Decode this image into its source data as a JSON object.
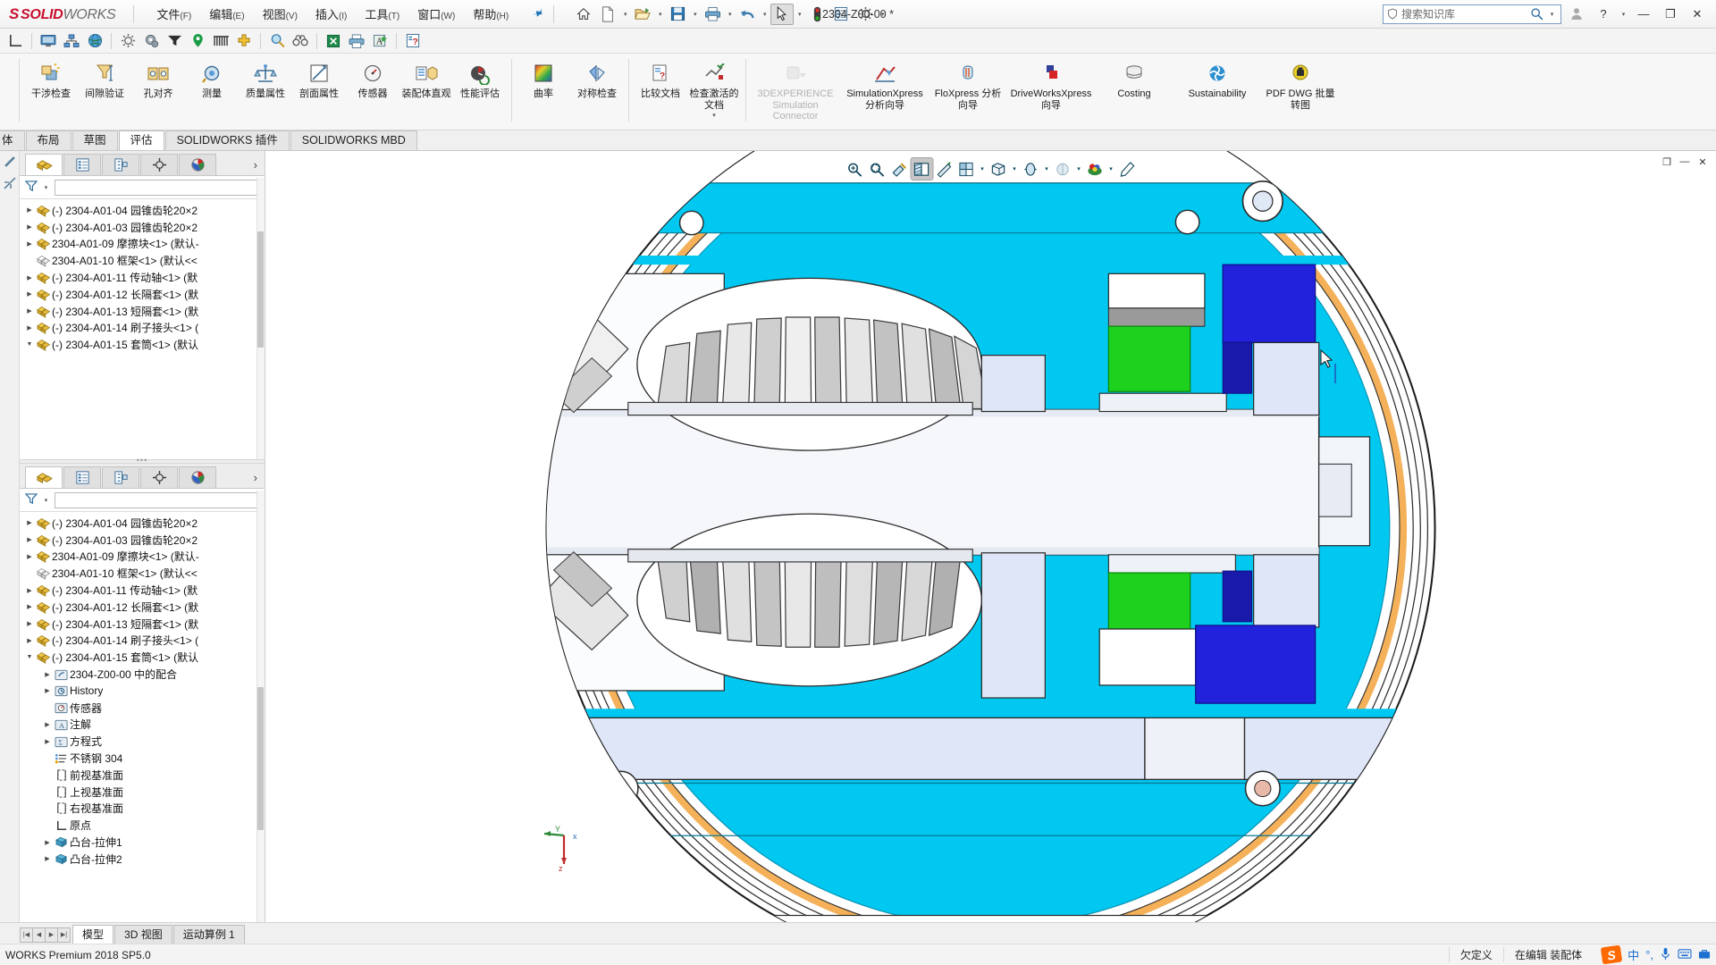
{
  "app": {
    "brand_mark": "S",
    "brand_solid": "SOLID",
    "brand_works": "WORKS",
    "document_title": "2304-Z00-00 *",
    "status_version": "WORKS Premium 2018 SP5.0",
    "accent_red": "#c8102e",
    "viewport_bg": "#00c8f0"
  },
  "menubar": [
    {
      "label": "文件",
      "mnemonic": "(F)"
    },
    {
      "label": "编辑",
      "mnemonic": "(E)"
    },
    {
      "label": "视图",
      "mnemonic": "(V)"
    },
    {
      "label": "插入",
      "mnemonic": "(I)"
    },
    {
      "label": "工具",
      "mnemonic": "(T)"
    },
    {
      "label": "窗口",
      "mnemonic": "(W)"
    },
    {
      "label": "帮助",
      "mnemonic": "(H)"
    }
  ],
  "quick_access": [
    {
      "name": "home-icon",
      "caret": false
    },
    {
      "name": "new-document-icon",
      "caret": true
    },
    {
      "name": "open-folder-icon",
      "caret": true
    },
    {
      "name": "save-icon",
      "caret": true
    },
    {
      "name": "print-icon",
      "caret": true
    },
    {
      "name": "undo-icon",
      "caret": true
    },
    {
      "name": "select-cursor-icon",
      "caret": true,
      "pressed": true
    },
    {
      "name": "rebuild-icon",
      "caret": false
    },
    {
      "name": "file-properties-icon",
      "caret": false
    },
    {
      "name": "options-gear-icon",
      "caret": true
    }
  ],
  "search": {
    "placeholder": "搜索知识库",
    "shield_icon": "knowledge-shield-icon",
    "magnifier_icon": "search-icon"
  },
  "window_controls": {
    "account": "user-account-icon",
    "help": "?",
    "help_caret": "▾",
    "minimize": "—",
    "restore": "❐",
    "close": "✕"
  },
  "toolbar2": [
    {
      "name": "coordinate-system-icon",
      "group": 0
    },
    {
      "name": "display-monitor-icon",
      "group": 1
    },
    {
      "name": "assembly-tree-icon",
      "group": 1
    },
    {
      "name": "globe-icon",
      "group": 1
    },
    {
      "name": "gear-settings-icon",
      "group": 2
    },
    {
      "name": "gears-icon",
      "group": 2
    },
    {
      "name": "funnel-icon",
      "group": 2
    },
    {
      "name": "location-pin-icon",
      "group": 2
    },
    {
      "name": "comb-icon",
      "group": 2
    },
    {
      "name": "add-yellow-cross-icon",
      "group": 2
    },
    {
      "name": "zoom-search-icon",
      "group": 3
    },
    {
      "name": "binoculars-icon",
      "group": 3
    },
    {
      "name": "excel-export-icon",
      "group": 4
    },
    {
      "name": "print-preview-icon",
      "group": 4
    },
    {
      "name": "text-image-icon",
      "group": 4
    },
    {
      "name": "help-document-icon",
      "group": 5
    }
  ],
  "ribbon": {
    "groups": [
      {
        "buttons": [
          {
            "label": "干涉检查",
            "icon": "interference-check-icon",
            "width": "normal",
            "disabled": false
          },
          {
            "label": "间隙验证",
            "icon": "clearance-verify-icon",
            "width": "normal",
            "disabled": false
          },
          {
            "label": "孔对齐",
            "icon": "hole-alignment-icon",
            "width": "normal",
            "disabled": false
          },
          {
            "label": "测量",
            "icon": "measure-icon",
            "width": "normal",
            "disabled": false
          },
          {
            "label": "质量属性",
            "icon": "mass-properties-icon",
            "width": "normal",
            "disabled": false
          },
          {
            "label": "剖面属性",
            "icon": "section-properties-icon",
            "width": "normal",
            "disabled": false
          },
          {
            "label": "传感器",
            "icon": "sensor-icon",
            "width": "normal",
            "disabled": false
          },
          {
            "label": "装配体直观",
            "icon": "assembly-visualization-icon",
            "width": "normal",
            "disabled": false
          },
          {
            "label": "性能评估",
            "icon": "performance-evaluation-icon",
            "width": "normal",
            "disabled": false
          }
        ]
      },
      {
        "buttons": [
          {
            "label": "曲率",
            "icon": "curvature-icon",
            "width": "normal",
            "disabled": false
          },
          {
            "label": "对称检查",
            "icon": "symmetry-check-icon",
            "width": "normal",
            "disabled": false
          }
        ]
      },
      {
        "buttons": [
          {
            "label": "比较文档",
            "icon": "compare-documents-icon",
            "width": "normal",
            "disabled": false
          },
          {
            "label": "检查激活的文档",
            "icon": "check-active-document-icon",
            "width": "normal",
            "disabled": false,
            "caret": true
          }
        ]
      },
      {
        "buttons": [
          {
            "label": "3DEXPERIENCE Simulation Connector",
            "icon": "3dexperience-simulation-connector-icon",
            "width": "wider",
            "disabled": true
          },
          {
            "label": "SimulationXpress 分析向导",
            "icon": "simulationxpress-icon",
            "width": "wider",
            "disabled": false
          },
          {
            "label": "FloXpress 分析向导",
            "icon": "floxpress-icon",
            "width": "wide",
            "disabled": false
          },
          {
            "label": "DriveWorksXpress 向导",
            "icon": "driveworksxpress-icon",
            "width": "wider",
            "disabled": false
          },
          {
            "label": "Costing",
            "icon": "costing-icon",
            "width": "wide",
            "disabled": false
          },
          {
            "label": "Sustainability",
            "icon": "sustainability-icon",
            "width": "wider",
            "disabled": false
          },
          {
            "label": "PDF DWG 批量转图",
            "icon": "pdf-dwg-batch-icon",
            "width": "wide",
            "disabled": false
          }
        ]
      }
    ]
  },
  "command_tabs": [
    {
      "label": "体",
      "active": false,
      "partial": true
    },
    {
      "label": "布局",
      "active": false
    },
    {
      "label": "草图",
      "active": false
    },
    {
      "label": "评估",
      "active": true
    },
    {
      "label": "SOLIDWORKS 插件",
      "active": false
    },
    {
      "label": "SOLIDWORKS MBD",
      "active": false
    }
  ],
  "tree_tabs": [
    {
      "name": "feature-manager-tab",
      "icon": "feature-tree-icon",
      "active": true
    },
    {
      "name": "property-manager-tab",
      "icon": "property-list-icon",
      "active": false
    },
    {
      "name": "configuration-manager-tab",
      "icon": "configuration-icon",
      "active": false
    },
    {
      "name": "dimxpert-manager-tab",
      "icon": "dimxpert-icon",
      "active": false
    },
    {
      "name": "display-manager-tab",
      "icon": "display-palette-icon",
      "active": false
    }
  ],
  "tree_top": {
    "items": [
      {
        "label": "(-) 2304-A01-04 园锥齿轮20×2",
        "icon": "part-icon",
        "twist": "closed",
        "indent": 0
      },
      {
        "label": "(-) 2304-A01-03 园锥齿轮20×2",
        "icon": "part-icon",
        "twist": "closed",
        "indent": 0
      },
      {
        "label": "2304-A01-09 摩擦块<1> (默认-",
        "icon": "part-icon",
        "twist": "closed",
        "indent": 0
      },
      {
        "label": "2304-A01-10 框架<1> (默认<<",
        "icon": "part-grey-icon",
        "twist": "none",
        "indent": 0
      },
      {
        "label": "(-) 2304-A01-11 传动轴<1> (默",
        "icon": "part-icon",
        "twist": "closed",
        "indent": 0
      },
      {
        "label": "(-) 2304-A01-12 长隔套<1> (默",
        "icon": "part-icon",
        "twist": "closed",
        "indent": 0
      },
      {
        "label": "(-) 2304-A01-13 短隔套<1> (默",
        "icon": "part-icon",
        "twist": "closed",
        "indent": 0
      },
      {
        "label": "(-) 2304-A01-14 刷子接头<1> (",
        "icon": "part-icon",
        "twist": "closed",
        "indent": 0
      },
      {
        "label": "(-) 2304-A01-15 套筒<1> (默认",
        "icon": "part-icon",
        "twist": "open",
        "indent": 0
      }
    ]
  },
  "tree_bottom": {
    "items": [
      {
        "label": "(-) 2304-A01-04 园锥齿轮20×2",
        "icon": "part-icon",
        "twist": "closed",
        "indent": 0
      },
      {
        "label": "(-) 2304-A01-03 园锥齿轮20×2",
        "icon": "part-icon",
        "twist": "closed",
        "indent": 0
      },
      {
        "label": "2304-A01-09 摩擦块<1> (默认-",
        "icon": "part-icon",
        "twist": "closed",
        "indent": 0
      },
      {
        "label": "2304-A01-10 框架<1> (默认<<",
        "icon": "part-grey-icon",
        "twist": "none",
        "indent": 0
      },
      {
        "label": "(-) 2304-A01-11 传动轴<1> (默",
        "icon": "part-icon",
        "twist": "closed",
        "indent": 0
      },
      {
        "label": "(-) 2304-A01-12 长隔套<1> (默",
        "icon": "part-icon",
        "twist": "closed",
        "indent": 0
      },
      {
        "label": "(-) 2304-A01-13 短隔套<1> (默",
        "icon": "part-icon",
        "twist": "closed",
        "indent": 0
      },
      {
        "label": "(-) 2304-A01-14 刷子接头<1> (",
        "icon": "part-icon",
        "twist": "closed",
        "indent": 0
      },
      {
        "label": "(-) 2304-A01-15 套筒<1> (默认",
        "icon": "part-icon",
        "twist": "open",
        "indent": 0
      },
      {
        "label": "2304-Z00-00 中的配合",
        "icon": "mates-folder-icon",
        "twist": "closed",
        "indent": 1
      },
      {
        "label": "History",
        "icon": "history-folder-icon",
        "twist": "closed",
        "indent": 1
      },
      {
        "label": "传感器",
        "icon": "sensors-folder-icon",
        "twist": "none",
        "indent": 1
      },
      {
        "label": "注解",
        "icon": "annotations-folder-icon",
        "twist": "closed",
        "indent": 1
      },
      {
        "label": "方程式",
        "icon": "equations-folder-icon",
        "twist": "closed",
        "indent": 1
      },
      {
        "label": "不锈钢 304",
        "icon": "material-icon",
        "twist": "none",
        "indent": 1
      },
      {
        "label": "前视基准面",
        "icon": "plane-icon",
        "twist": "none",
        "indent": 1
      },
      {
        "label": "上视基准面",
        "icon": "plane-icon",
        "twist": "none",
        "indent": 1
      },
      {
        "label": "右视基准面",
        "icon": "plane-icon",
        "twist": "none",
        "indent": 1
      },
      {
        "label": "原点",
        "icon": "origin-icon",
        "twist": "none",
        "indent": 1
      },
      {
        "label": "凸台-拉伸1",
        "icon": "boss-extrude-icon",
        "twist": "closed",
        "indent": 1
      },
      {
        "label": "凸台-拉伸2",
        "icon": "boss-extrude-icon",
        "twist": "closed",
        "indent": 1
      }
    ]
  },
  "heads_up": [
    {
      "name": "zoom-to-fit-icon",
      "caret": false,
      "active": false
    },
    {
      "name": "zoom-to-area-icon",
      "caret": false,
      "active": false
    },
    {
      "name": "previous-view-icon",
      "caret": false,
      "active": false
    },
    {
      "name": "section-view-icon",
      "caret": false,
      "active": true
    },
    {
      "name": "measure-hud-icon",
      "caret": false,
      "active": false
    },
    {
      "name": "view-orientation-icon",
      "caret": true,
      "active": false
    },
    {
      "name": "display-style-icon",
      "caret": true,
      "active": false
    },
    {
      "name": "hide-show-items-icon",
      "caret": true,
      "active": false
    },
    {
      "name": "edit-appearance-icon",
      "caret": true,
      "active": false,
      "disabled": true
    },
    {
      "name": "apply-scene-icon",
      "caret": true,
      "active": false
    },
    {
      "name": "view-settings-icon",
      "caret": false,
      "active": false
    }
  ],
  "viewport_window_controls": [
    "❐",
    "—",
    "✕"
  ],
  "triad": {
    "x_label": "x",
    "y_label": "Y",
    "z_label": "z"
  },
  "bottom_tabs": [
    {
      "label": "模型",
      "active": true
    },
    {
      "label": "3D 视图",
      "active": false
    },
    {
      "label": "运动算例 1",
      "active": false
    }
  ],
  "status": {
    "left": "WORKS Premium 2018 SP5.0",
    "segments": [
      "欠定义",
      "在编辑 装配体"
    ],
    "ime": {
      "logo": "S",
      "mode": "中",
      "punct": "°,",
      "mic": "microphone-icon",
      "keyboard": "keyboard-icon",
      "extra": "toolbox-icon"
    }
  }
}
